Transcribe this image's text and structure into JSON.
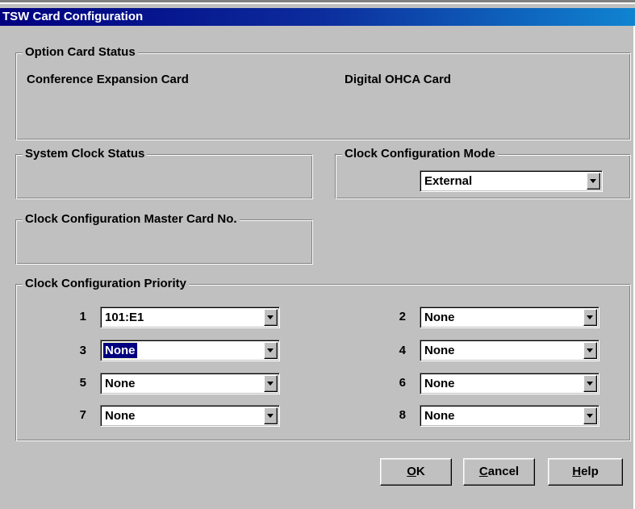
{
  "window": {
    "title": "TSW Card Configuration"
  },
  "option_card_status": {
    "legend": "Option Card Status",
    "cards": [
      "Conference Expansion Card",
      "Digital OHCA Card"
    ]
  },
  "system_clock_status": {
    "legend": "System Clock Status"
  },
  "clock_mode": {
    "legend": "Clock Configuration Mode",
    "value": "External"
  },
  "master_card": {
    "legend": "Clock Configuration Master Card No."
  },
  "priority": {
    "legend": "Clock Configuration Priority",
    "items": [
      {
        "num": "1",
        "value": "101:E1"
      },
      {
        "num": "2",
        "value": "None"
      },
      {
        "num": "3",
        "value": "None",
        "selected": true
      },
      {
        "num": "4",
        "value": "None"
      },
      {
        "num": "5",
        "value": "None"
      },
      {
        "num": "6",
        "value": "None"
      },
      {
        "num": "7",
        "value": "None"
      },
      {
        "num": "8",
        "value": "None"
      }
    ]
  },
  "buttons": {
    "ok": {
      "mnemonic": "O",
      "rest": "K"
    },
    "cancel": {
      "mnemonic": "C",
      "rest": "ancel"
    },
    "help": {
      "mnemonic": "H",
      "rest": "elp"
    }
  },
  "colors": {
    "face": "#c0c0c0",
    "title_start": "#000080",
    "title_end": "#1084d0",
    "selection": "#000080"
  }
}
